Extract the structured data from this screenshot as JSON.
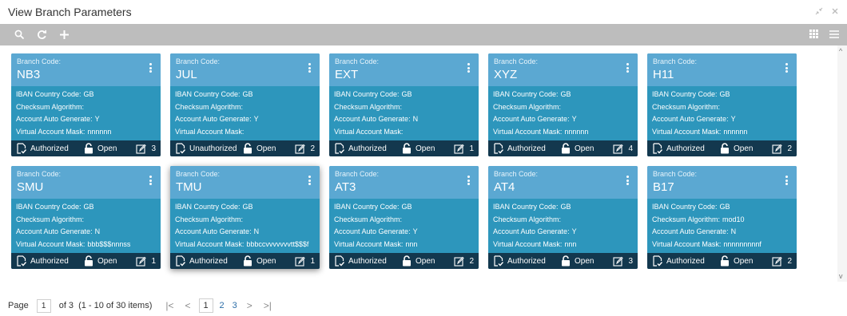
{
  "window": {
    "title": "View Branch Parameters"
  },
  "labels": {
    "branch_code": "Branch Code:",
    "iban_country_code": "IBAN Country Code:",
    "checksum_algorithm": "Checksum Algorithm:",
    "account_auto_generate": "Account Auto Generate:",
    "virtual_account_mask": "Virtual Account Mask:"
  },
  "cards": [
    {
      "branch_code": "NB3",
      "iban_country_code": "GB",
      "checksum_algorithm": "",
      "account_auto_generate": "Y",
      "virtual_account_mask": "nnnnnn",
      "auth_status": "Authorized",
      "record_status": "Open",
      "mod_count": "3"
    },
    {
      "branch_code": "JUL",
      "iban_country_code": "GB",
      "checksum_algorithm": "",
      "account_auto_generate": "Y",
      "virtual_account_mask": "",
      "auth_status": "Unauthorized",
      "record_status": "Open",
      "mod_count": "2"
    },
    {
      "branch_code": "EXT",
      "iban_country_code": "GB",
      "checksum_algorithm": "",
      "account_auto_generate": "N",
      "virtual_account_mask": "",
      "auth_status": "Authorized",
      "record_status": "Open",
      "mod_count": "1"
    },
    {
      "branch_code": "XYZ",
      "iban_country_code": "GB",
      "checksum_algorithm": "",
      "account_auto_generate": "Y",
      "virtual_account_mask": "nnnnnn",
      "auth_status": "Authorized",
      "record_status": "Open",
      "mod_count": "4"
    },
    {
      "branch_code": "H11",
      "iban_country_code": "GB",
      "checksum_algorithm": "",
      "account_auto_generate": "Y",
      "virtual_account_mask": "nnnnnn",
      "auth_status": "Authorized",
      "record_status": "Open",
      "mod_count": "2"
    },
    {
      "branch_code": "SMU",
      "iban_country_code": "GB",
      "checksum_algorithm": "",
      "account_auto_generate": "N",
      "virtual_account_mask": "bbb$$$nnnss",
      "auth_status": "Authorized",
      "record_status": "Open",
      "mod_count": "1"
    },
    {
      "branch_code": "TMU",
      "iban_country_code": "GB",
      "checksum_algorithm": "",
      "account_auto_generate": "N",
      "virtual_account_mask": "bbbccvvvvvvvtt$$$f",
      "auth_status": "Authorized",
      "record_status": "Open",
      "mod_count": "1"
    },
    {
      "branch_code": "AT3",
      "iban_country_code": "GB",
      "checksum_algorithm": "",
      "account_auto_generate": "Y",
      "virtual_account_mask": "nnn",
      "auth_status": "Authorized",
      "record_status": "Open",
      "mod_count": "2"
    },
    {
      "branch_code": "AT4",
      "iban_country_code": "GB",
      "checksum_algorithm": "",
      "account_auto_generate": "Y",
      "virtual_account_mask": "nnn",
      "auth_status": "Authorized",
      "record_status": "Open",
      "mod_count": "3"
    },
    {
      "branch_code": "B17",
      "iban_country_code": "GB",
      "checksum_algorithm": "mod10",
      "account_auto_generate": "N",
      "virtual_account_mask": "nnnnnnnnnf",
      "auth_status": "Authorized",
      "record_status": "Open",
      "mod_count": "2"
    }
  ],
  "pagination": {
    "page_label": "Page",
    "current_page": "1",
    "of_label": "of 3",
    "range_label": "(1 - 10 of 30 items)",
    "pages": [
      "1",
      "2",
      "3"
    ]
  },
  "colors": {
    "card_body": "#2d96bc",
    "card_header": "#5ba8d2",
    "card_footer": "#13384e",
    "toolbar": "#bdbdbd"
  }
}
